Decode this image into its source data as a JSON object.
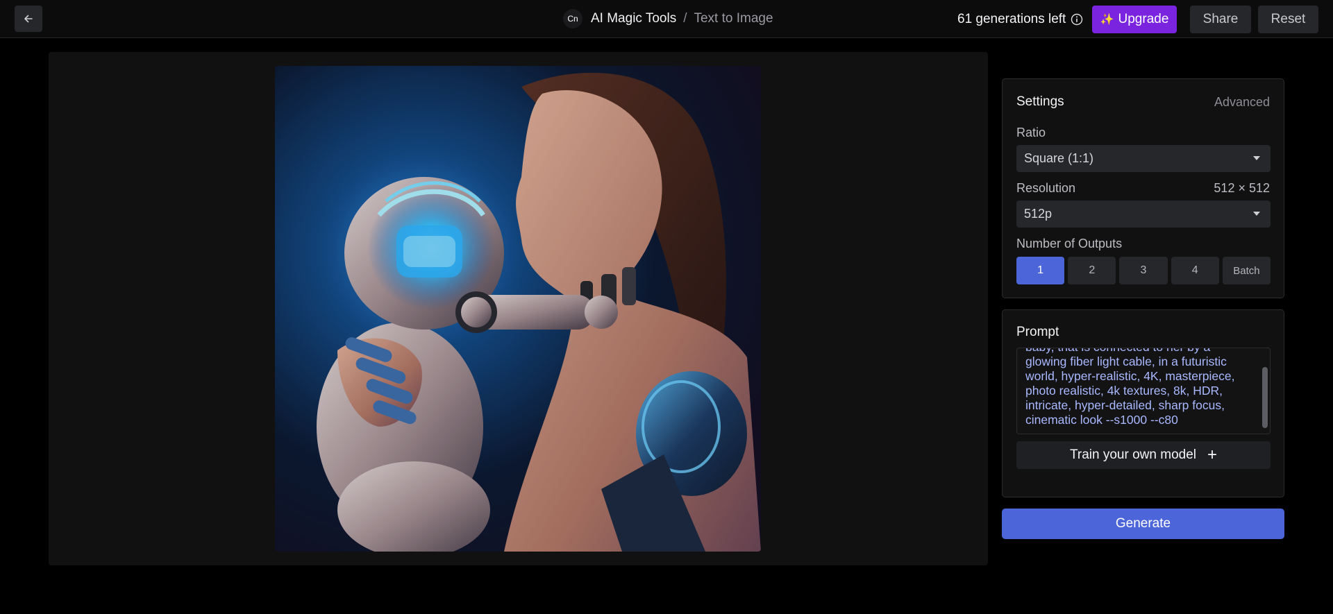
{
  "header": {
    "back_icon": "arrow-left-icon",
    "logo_text": "Cn",
    "app_name": "AI Magic Tools",
    "separator": "/",
    "current_page": "Text to Image",
    "generations_left": "61 generations left",
    "info_icon": "info-circle-icon",
    "upgrade_label": "Upgrade",
    "upgrade_icon": "sparkles-icon",
    "share_label": "Share",
    "reset_label": "Reset"
  },
  "canvas": {
    "image_alt": "Generated image: woman cradling a glowing robot baby"
  },
  "settings": {
    "title": "Settings",
    "advanced_label": "Advanced",
    "ratio_label": "Ratio",
    "ratio_value": "Square (1:1)",
    "resolution_label": "Resolution",
    "resolution_dimensions": "512 × 512",
    "resolution_value": "512p",
    "outputs_label": "Number of Outputs",
    "output_options": [
      "1",
      "2",
      "3",
      "4",
      "Batch"
    ],
    "selected_output": "1"
  },
  "prompt": {
    "title": "Prompt",
    "lines": [
      "baby, that is connected to her by a",
      "glowing fiber light cable, in a futuristic",
      "world, hyper-realistic, 4K, masterpiece,",
      "photo realistic, 4k textures, 8k, HDR,",
      "intricate, hyper-detailed, sharp focus,",
      "cinematic look --s1000 --c80"
    ],
    "train_label": "Train your own model",
    "train_icon": "plus-icon"
  },
  "generate_label": "Generate",
  "colors": {
    "accent": "#4c66d9",
    "upgrade": "#7b24e0",
    "prompt_text": "#a9b8ff"
  }
}
